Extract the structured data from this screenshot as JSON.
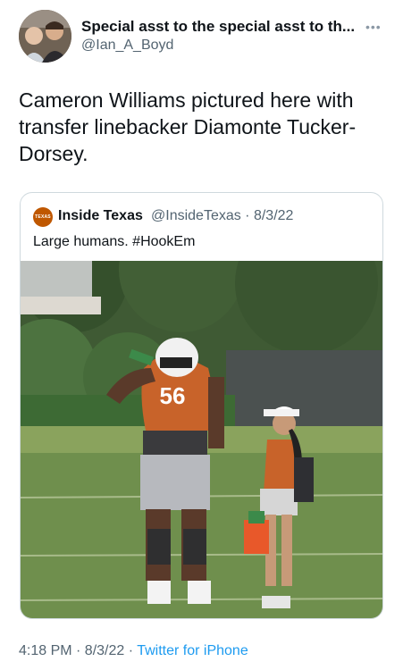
{
  "tweet": {
    "display_name": "Special asst to the special asst to th...",
    "handle": "@Ian_A_Boyd",
    "text": "Cameron Williams pictured here with transfer linebacker Diamonte Tucker-Dorsey.",
    "more_icon": "ellipsis-icon"
  },
  "quoted": {
    "logo_text": "TEXAS",
    "display_name": "Inside Texas",
    "handle_date": "@InsideTexas · 8/3/22",
    "text": "Large humans. #HookEm",
    "jersey_number": "56"
  },
  "footer": {
    "time_date": "4:18 PM · 8/3/22 · ",
    "source": "Twitter for iPhone"
  },
  "colors": {
    "link": "#1d9bf0",
    "secondary_text": "#536471",
    "texas_orange": "#bf5700"
  }
}
